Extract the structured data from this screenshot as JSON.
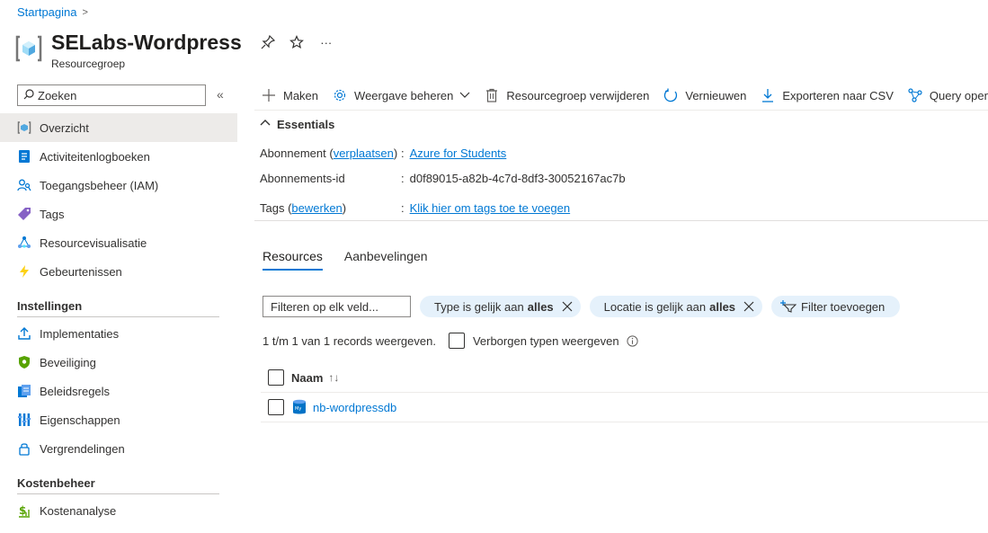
{
  "breadcrumb": {
    "home": "Startpagina",
    "separator": ">"
  },
  "header": {
    "title": "SELabs-Wordpress",
    "subtitle": "Resourcegroep",
    "actions": [
      "pin-icon",
      "star-icon",
      "more-icon"
    ],
    "more_label": "···"
  },
  "sidebar": {
    "search_placeholder": "Zoeken",
    "collapse_label": "«",
    "items": [
      {
        "label": "Overzicht",
        "icon": "resource-group-icon",
        "active": true
      },
      {
        "label": "Activiteitenlogboeken",
        "icon": "activity-log-icon"
      },
      {
        "label": "Toegangsbeheer (IAM)",
        "icon": "iam-icon"
      },
      {
        "label": "Tags",
        "icon": "tag-icon"
      },
      {
        "label": "Resourcevisualisatie",
        "icon": "visualizer-icon"
      },
      {
        "label": "Gebeurtenissen",
        "icon": "lightning-icon"
      }
    ],
    "sections": [
      {
        "title": "Instellingen",
        "items": [
          {
            "label": "Implementaties",
            "icon": "deploy-icon"
          },
          {
            "label": "Beveiliging",
            "icon": "shield-icon"
          },
          {
            "label": "Beleidsregels",
            "icon": "policy-icon"
          },
          {
            "label": "Eigenschappen",
            "icon": "properties-icon"
          },
          {
            "label": "Vergrendelingen",
            "icon": "lock-icon"
          }
        ]
      },
      {
        "title": "Kostenbeheer",
        "items": [
          {
            "label": "Kostenanalyse",
            "icon": "cost-analysis-icon"
          }
        ]
      }
    ]
  },
  "toolbar": {
    "create": "Maken",
    "manage_view": "Weergave beheren",
    "delete_group": "Resourcegroep verwijderen",
    "refresh": "Vernieuwen",
    "export_csv": "Exporteren naar CSV",
    "query": "Query opene"
  },
  "essentials": {
    "heading": "Essentials",
    "subscription_label": "Abonnement",
    "subscription_move": "verplaatsen",
    "subscription_value": "Azure for Students",
    "subscription_id_label": "Abonnements-id",
    "subscription_id_value": "d0f89015-a82b-4c7d-8df3-30052167ac7b",
    "tags_label": "Tags",
    "tags_edit": "bewerken",
    "tags_value": "Klik hier om tags toe te voegen",
    "colon": ":"
  },
  "tabs": [
    {
      "label": "Resources",
      "active": true
    },
    {
      "label": "Aanbevelingen",
      "active": false
    }
  ],
  "filters": {
    "placeholder": "Filteren op elk veld...",
    "type_pill": {
      "prefix": "Type is gelijk aan",
      "value": "alles"
    },
    "location_pill": {
      "prefix": "Locatie is gelijk aan",
      "value": "alles"
    },
    "add_filter": "Filter toevoegen"
  },
  "records": {
    "count_text": "1 t/m 1 van 1 records weergeven.",
    "hidden_types_label": "Verborgen typen weergeven"
  },
  "table": {
    "columns": [
      {
        "label": "Naam",
        "sort": "↑↓"
      }
    ],
    "rows": [
      {
        "name": "nb-wordpressdb",
        "icon": "mysql-database-icon"
      }
    ]
  },
  "colors": {
    "accent": "#0078d4",
    "active_nav": "#edebe9",
    "pill_bg": "#e5f1fb"
  }
}
